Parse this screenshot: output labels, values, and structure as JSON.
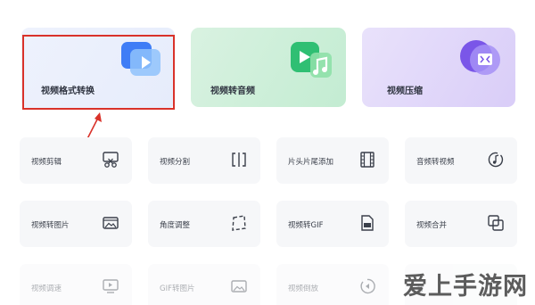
{
  "feature_cards": [
    {
      "title": "视频格式转换",
      "icon": "video-play-icon"
    },
    {
      "title": "视频转音频",
      "icon": "video-music-icon"
    },
    {
      "title": "视频压缩",
      "icon": "video-compress-icon"
    }
  ],
  "tools": [
    {
      "label": "视频剪辑",
      "icon": "scissors-icon"
    },
    {
      "label": "视频分割",
      "icon": "split-icon"
    },
    {
      "label": "片头片尾添加",
      "icon": "film-icon"
    },
    {
      "label": "音频转视频",
      "icon": "music-note-icon"
    },
    {
      "label": "视频转图片",
      "icon": "image-icon"
    },
    {
      "label": "角度调整",
      "icon": "rotate-icon"
    },
    {
      "label": "视频转GIF",
      "icon": "gif-file-icon"
    },
    {
      "label": "视频合并",
      "icon": "merge-icon"
    },
    {
      "label": "视频调速",
      "icon": "monitor-speed-icon"
    },
    {
      "label": "GIF转图片",
      "icon": "gif-image-icon"
    },
    {
      "label": "视频倒放",
      "icon": "reverse-icon"
    },
    {
      "label": "音",
      "icon": "audio-icon"
    }
  ],
  "watermark": "爱上手游网",
  "colors": {
    "highlight": "#d9322a",
    "convert_accent": "#3f7df6",
    "audio_accent": "#2fbf73",
    "compress_accent": "#7a56e8"
  }
}
